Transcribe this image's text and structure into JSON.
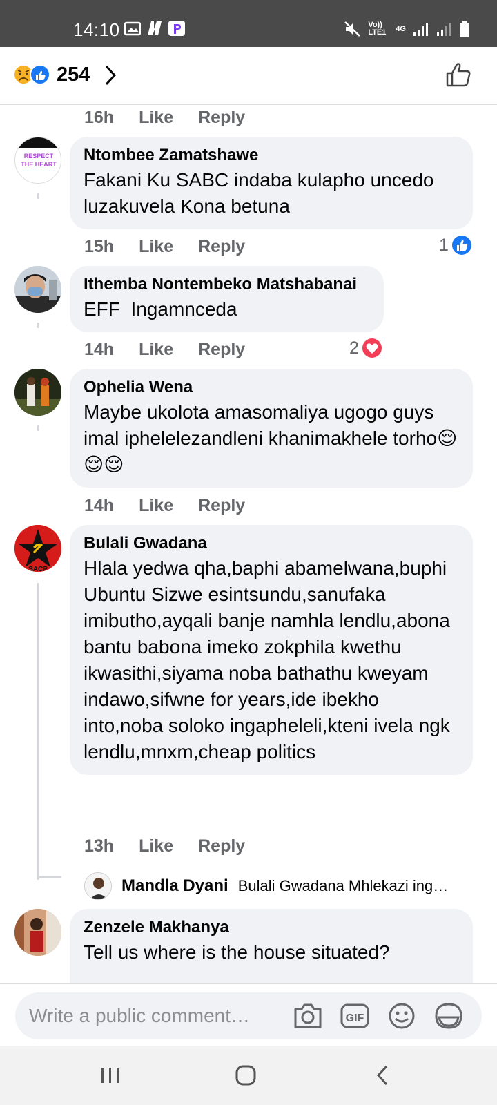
{
  "status_bar": {
    "time": "14:10",
    "left_icons": [
      "image-icon",
      "netflix-n-icon",
      "pinterest-p-icon"
    ],
    "network": "Vo)) LTE1",
    "network_type": "4G"
  },
  "reactions": {
    "count": "254",
    "emojis": [
      "sad-emoji",
      "like-emoji"
    ]
  },
  "top_meta": {
    "time": "16h",
    "like": "Like",
    "reply": "Reply"
  },
  "comments": [
    {
      "author": "Ntombee Zamatshawe",
      "text": "Fakani Ku SABC indaba kulapho uncedo luzakuvela Kona betuna",
      "time": "15h",
      "like": "Like",
      "reply": "Reply",
      "reaction_count": "1",
      "reaction_type": "like"
    },
    {
      "author": "Ithemba Nontembeko Matshabanai",
      "text": "EFF  Ingamnceda",
      "time": "14h",
      "like": "Like",
      "reply": "Reply",
      "reaction_count": "2",
      "reaction_type": "love"
    },
    {
      "author": "Ophelia Wena",
      "text": "Maybe ukolota amasomaliya ugogo guys imal iphelelezandleni khanimakhele torho😌😌😌",
      "time": "14h",
      "like": "Like",
      "reply": "Reply"
    },
    {
      "author": "Bulali Gwadana",
      "text": "Hlala yedwa qha,baphi abamelwana,buphi Ubuntu Sizwe esintsundu,sanufaka imibutho,ayqali banje namhla lendlu,abona bantu babona imeko zokphila kwethu ikwasithi,siyama noba bathathu kweyam indawo,sifwne for years,ide ibekho into,noba soloko ingapheleli,kteni ivela ngk lendlu,mnxm,cheap politics",
      "time": "13h",
      "like": "Like",
      "reply": "Reply"
    },
    {
      "author": "Zenzele Makhanya",
      "text": "Tell us where is the house situated?"
    }
  ],
  "reply_preview": {
    "author": "Mandla Dyani",
    "text": "Bulali Gwadana Mhlekazi ing…"
  },
  "composer": {
    "placeholder": "Write a public comment…",
    "icons": [
      "camera-icon",
      "gif-icon",
      "emoji-icon",
      "sticker-icon"
    ]
  },
  "avatar_texts": {
    "respect": "RESPECT THE HEART",
    "sacp": "SACP"
  },
  "colors": {
    "facebook_blue": "#1877f2",
    "love_red": "#f33e58",
    "bubble_bg": "#f0f2f5",
    "meta_gray": "#65676b"
  }
}
